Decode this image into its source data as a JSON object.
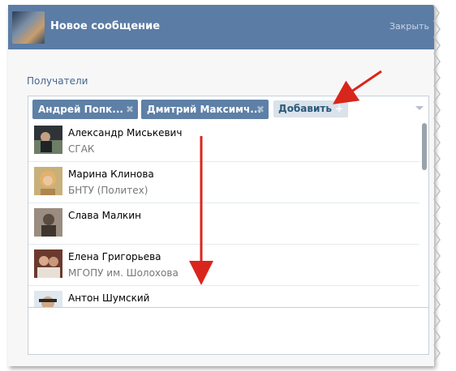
{
  "header": {
    "title": "Новое сообщение",
    "close_label": "Закрыть"
  },
  "recipients": {
    "label": "Получатели",
    "tokens": [
      {
        "name": "Андрей Попк...",
        "remove_icon": "close-icon"
      },
      {
        "name": "Дмитрий Максимч...",
        "remove_icon": "close-icon"
      }
    ],
    "add_label": "Добавить",
    "add_icon": "+"
  },
  "contacts": [
    {
      "name": "Александр Миськевич",
      "subtitle": "СГАК",
      "avatar_color": "#3a3f45"
    },
    {
      "name": "Марина Клинова",
      "subtitle": "БНТУ (Политех)",
      "avatar_color": "#d9b25c"
    },
    {
      "name": "Слава Малкин",
      "subtitle": "",
      "avatar_color": "#5a5048"
    },
    {
      "name": "Елена Григорьева",
      "subtitle": "МГОПУ им. Шолохова",
      "avatar_color": "#7a4a3a"
    },
    {
      "name": "Антон Шумский",
      "subtitle": "",
      "avatar_color": "#c8a58a"
    }
  ],
  "colors": {
    "header_bg": "#5b7ca5",
    "token_bg": "#5e80a6",
    "arrow": "#d9261c"
  }
}
